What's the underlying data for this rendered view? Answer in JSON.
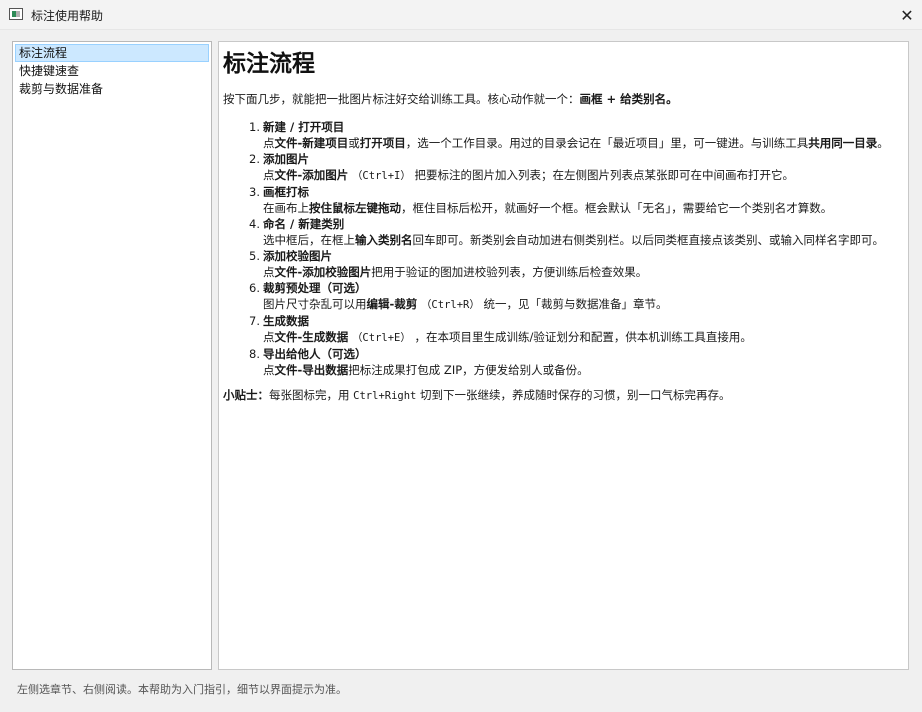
{
  "window": {
    "title": "标注使用帮助",
    "close": "✕"
  },
  "sidebar": {
    "items": [
      {
        "label": "标注流程"
      },
      {
        "label": "快捷键速查"
      },
      {
        "label": "裁剪与数据准备"
      }
    ]
  },
  "content": {
    "heading": "标注流程",
    "intro": {
      "text": "按下面几步，就能把一批图片标注好交给训练工具。核心动作就一个：",
      "bold": "画框 + 给类别名。"
    },
    "steps": [
      {
        "n": "1.",
        "title": "新建 / 打开项目",
        "p1": "点",
        "b1": "文件-新建项目",
        "p2": "或",
        "b2": "打开项目",
        "p3": "，选一个工作目录。用过的目录会记在「最近项目」里，可一键进。与训练工具",
        "b3": "共用同一目录",
        "p4": "。"
      },
      {
        "n": "2.",
        "title": "添加图片",
        "p1": "点",
        "b1": "文件-添加图片",
        "code": "（Ctrl+I）",
        "p2": "把要标注的图片加入列表；在左侧图片列表点某张即可在中间画布打开它。"
      },
      {
        "n": "3.",
        "title": "画框打标",
        "p1": "在画布上",
        "b1": "按住鼠标左键拖动",
        "p2": "，框住目标后松开，就画好一个框。框会默认「无名」，需要给它一个类别名才算数。"
      },
      {
        "n": "4.",
        "title": "命名 / 新建类别",
        "p1": "选中框后，在框上",
        "b1": "输入类别名",
        "p2": "回车即可。新类别会自动加进右侧类别栏。以后同类框直接点该类别、或输入同样名字即可。"
      },
      {
        "n": "5.",
        "title": "添加校验图片",
        "p1": "点",
        "b1": "文件-添加校验图片",
        "p2": "把用于验证的图加进校验列表，方便训练后检查效果。"
      },
      {
        "n": "6.",
        "title": "裁剪预处理（可选）",
        "p1": "图片尺寸杂乱可以用",
        "b1": "编辑-裁剪",
        "code": "（Ctrl+R）",
        "p2": "统一，见「裁剪与数据准备」章节。"
      },
      {
        "n": "7.",
        "title": "生成数据",
        "p1": "点",
        "b1": "文件-生成数据",
        "code": "（Ctrl+E）",
        "p2": "，在本项目里生成训练/验证划分和配置，供本机训练工具直接用。"
      },
      {
        "n": "8.",
        "title": "导出给他人（可选）",
        "p1": "点",
        "b1": "文件-导出数据",
        "p2": "把标注成果打包成 ZIP，方便发给别人或备份。"
      }
    ],
    "tip": {
      "label": "小贴士：",
      "p1": "每张图标完，用 ",
      "code": "Ctrl+Right",
      "p2": " 切到下一张继续，养成随时保存的习惯，别一口气标完再存。"
    }
  },
  "statusbar": {
    "text": "左侧选章节、右侧阅读。本帮助为入门指引，细节以界面提示为准。"
  }
}
